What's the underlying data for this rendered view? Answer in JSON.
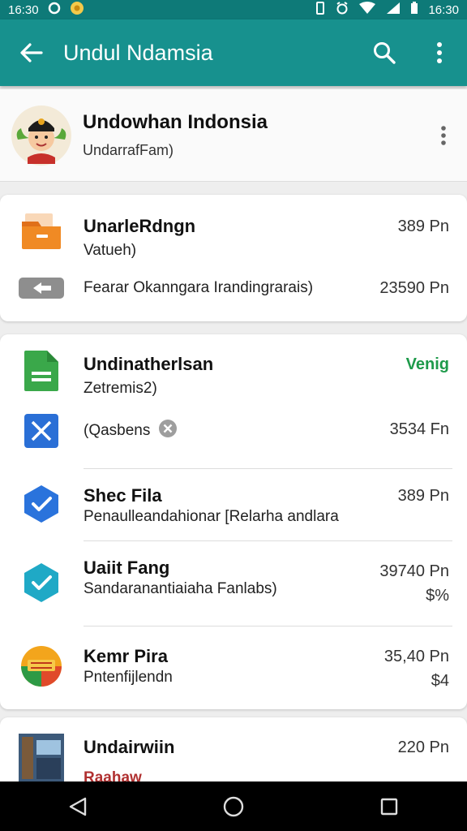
{
  "status_bar": {
    "time_left": "16:30",
    "time_right": "16:30"
  },
  "app_bar": {
    "title": "Undul Ndamsia"
  },
  "profile": {
    "name": "Undowhan Indonsia",
    "subtitle": "UndarrafFam)"
  },
  "card1": {
    "title": "UnarleRdngn",
    "subtitle": "Vatueh)",
    "amount1": "389 Pn",
    "detail": "Fearar Okanngara Irandingrarais)",
    "amount2": "23590 Pn"
  },
  "card2": {
    "title": "Undinatherlsan",
    "subtitle": "Zetremis2)",
    "status": "Venig",
    "status_color": "#1e9a4a",
    "chip_label": "(Qasbens",
    "chip_amount": "3534 Fn",
    "items": [
      {
        "title": "Shec Fila",
        "subtitle": "Penaulleandahionar [Relarha andlara",
        "amount": "389 Pn",
        "amount2": ""
      },
      {
        "title": "Uaiit Fang",
        "subtitle": "Sandaranantiaiaha Fanlabs)",
        "amount": "39740 Pn",
        "amount2": "$%"
      },
      {
        "title": "Kemr Pira",
        "subtitle": "Pntenfijlendn",
        "amount": "35,40 Pn",
        "amount2": "$4"
      }
    ]
  },
  "card3": {
    "title": "Undairwiin",
    "amount": "220 Pn",
    "partial_text": "Raahaw"
  }
}
